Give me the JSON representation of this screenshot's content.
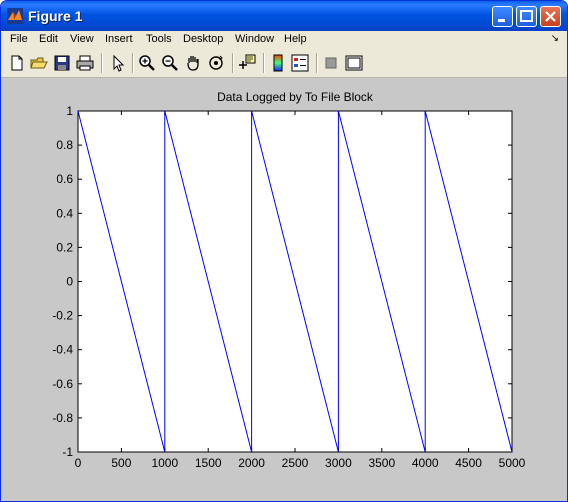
{
  "window": {
    "title": "Figure 1"
  },
  "menu": {
    "items": [
      "File",
      "Edit",
      "View",
      "Insert",
      "Tools",
      "Desktop",
      "Window",
      "Help"
    ],
    "dock_arrow": "↘"
  },
  "toolbar": {
    "icons": [
      "new-figure-icon",
      "open-file-icon",
      "save-icon",
      "print-icon",
      "pointer-icon",
      "zoom-in-icon",
      "zoom-out-icon",
      "pan-hand-icon",
      "rotate-3d-icon",
      "data-cursor-icon",
      "colorbar-icon",
      "legend-icon",
      "hide-plot-tools-icon",
      "show-plot-tools-icon"
    ]
  },
  "colors": {
    "line": "#0000ff",
    "axes_bg": "#ffffff",
    "figure_bg": "#c8c8c8",
    "titlebar": "#0054e3"
  },
  "chart_data": {
    "type": "line",
    "title": "Data Logged by To File Block",
    "xlabel": "",
    "ylabel": "",
    "xlim": [
      0,
      5000
    ],
    "ylim": [
      -1,
      1
    ],
    "xticks": [
      0,
      500,
      1000,
      1500,
      2000,
      2500,
      3000,
      3500,
      4000,
      4500,
      5000
    ],
    "yticks": [
      -1,
      -0.8,
      -0.6,
      -0.4,
      -0.2,
      0,
      0.2,
      0.4,
      0.6,
      0.8,
      1
    ],
    "ytick_labels": [
      "-1",
      "-0.8",
      "-0.6",
      "-0.4",
      "-0.2",
      "0",
      "0.2",
      "0.4",
      "0.6",
      "0.8",
      "1"
    ],
    "grid": false,
    "series": [
      {
        "x": [
          0,
          1000,
          1000,
          2000,
          2000,
          3000,
          3000,
          4000,
          4000,
          5000
        ],
        "y": [
          1,
          -1,
          1,
          -1,
          1,
          -1,
          1,
          -1,
          1,
          -1
        ]
      }
    ]
  }
}
